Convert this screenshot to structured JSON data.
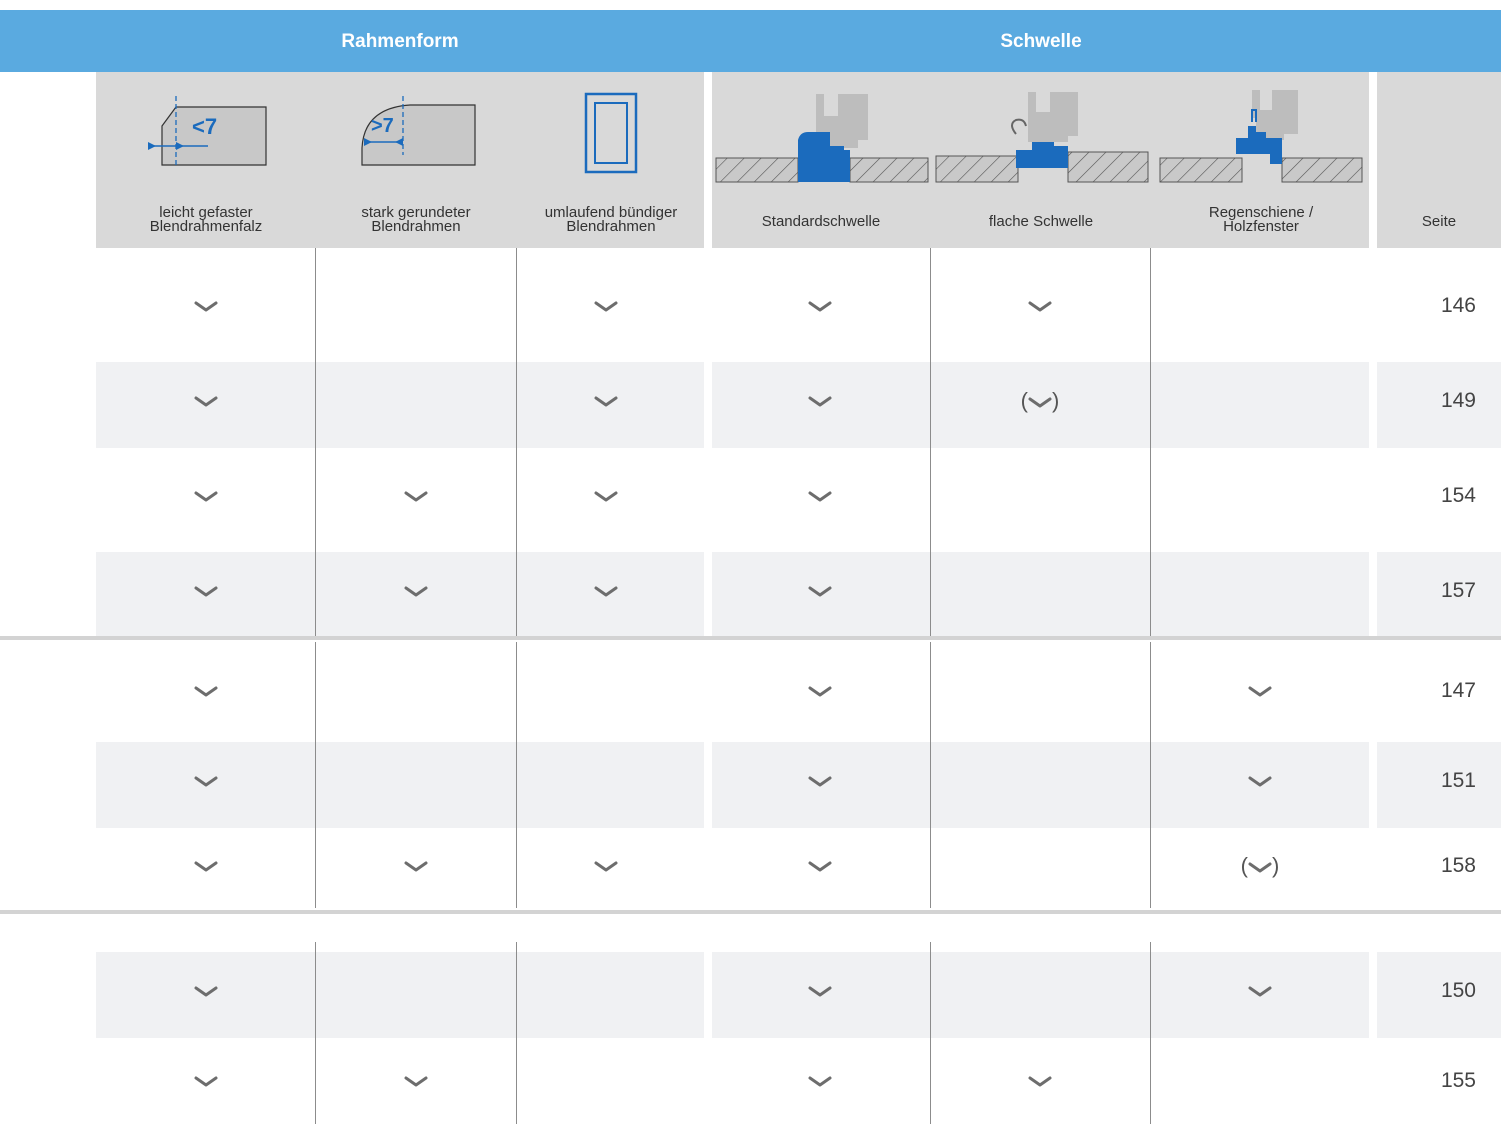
{
  "header": {
    "group_rahmenform": "Rahmenform",
    "group_schwelle": "Schwelle",
    "columns": [
      "leicht gefaster\nBlendrahmenfalz",
      "stark gerundeter\nBlendrahmen",
      "umlaufend bündiger\nBlendrahmen",
      "Standardschwelle",
      "flache Schwelle",
      "Regenschiene /\nHolzfenster",
      "Seite"
    ],
    "icon_labels": {
      "chamfer": "<7",
      "rounded": ">7"
    }
  },
  "colors": {
    "header_blue": "#5aaae0",
    "icon_blue": "#1b6bbd",
    "header_gray": "#d9d9d9",
    "row_gray": "#f0f1f3"
  },
  "rows": [
    {
      "cells": [
        "check",
        "",
        "check",
        "check",
        "check",
        ""
      ],
      "page": "146"
    },
    {
      "cells": [
        "check",
        "",
        "check",
        "check",
        "(check)",
        ""
      ],
      "page": "149"
    },
    {
      "cells": [
        "check",
        "check",
        "check",
        "check",
        "",
        ""
      ],
      "page": "154"
    },
    {
      "cells": [
        "check",
        "check",
        "check",
        "check",
        "",
        ""
      ],
      "page": "157"
    },
    {
      "cells": [
        "check",
        "",
        "",
        "check",
        "",
        "check"
      ],
      "page": "147"
    },
    {
      "cells": [
        "check",
        "",
        "",
        "check",
        "",
        "check"
      ],
      "page": "151"
    },
    {
      "cells": [
        "check",
        "check",
        "check",
        "check",
        "",
        "(check)"
      ],
      "page": "158"
    },
    {
      "cells": [
        "check",
        "",
        "",
        "check",
        "",
        "check"
      ],
      "page": "150"
    },
    {
      "cells": [
        "check",
        "check",
        "",
        "check",
        "check",
        ""
      ],
      "page": "155"
    }
  ]
}
